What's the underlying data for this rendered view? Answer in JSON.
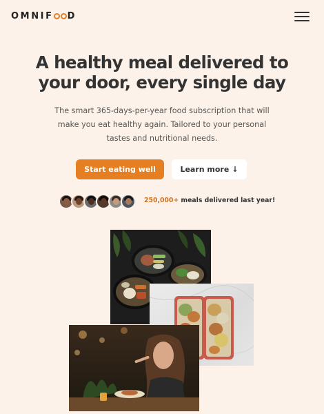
{
  "header": {
    "logo_left": "OMNIF",
    "logo_right": "D",
    "menu_icon": "hamburger-menu-icon"
  },
  "hero": {
    "title": "A healthy meal delivered to your door, every single day",
    "description": "The smart 365-days-per-year food subscription that will make you eat healthy again. Tailored to your personal tastes and nutritional needs.",
    "primary_button": "Start eating well",
    "secondary_button": "Learn more",
    "secondary_icon": "↓",
    "delivered_count": "250,000+",
    "delivered_text": " meals delivered last year!"
  },
  "colors": {
    "accent": "#e67e22",
    "background": "#fdf2e9",
    "text": "#333333"
  }
}
